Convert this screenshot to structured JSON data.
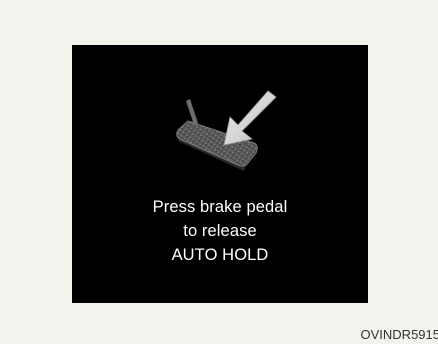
{
  "display": {
    "icon": "brake-pedal-icon",
    "message_line1": "Press brake pedal",
    "message_line2": "to release",
    "message_line3": "AUTO HOLD"
  },
  "reference_code": "OVINDR5915",
  "colors": {
    "page_background": "#f3f2ec",
    "screen_background": "#000000",
    "text": "#ffffff",
    "caption_text": "#333333",
    "pedal": "#5a5a5a",
    "arrow": "#d9d9d9"
  }
}
